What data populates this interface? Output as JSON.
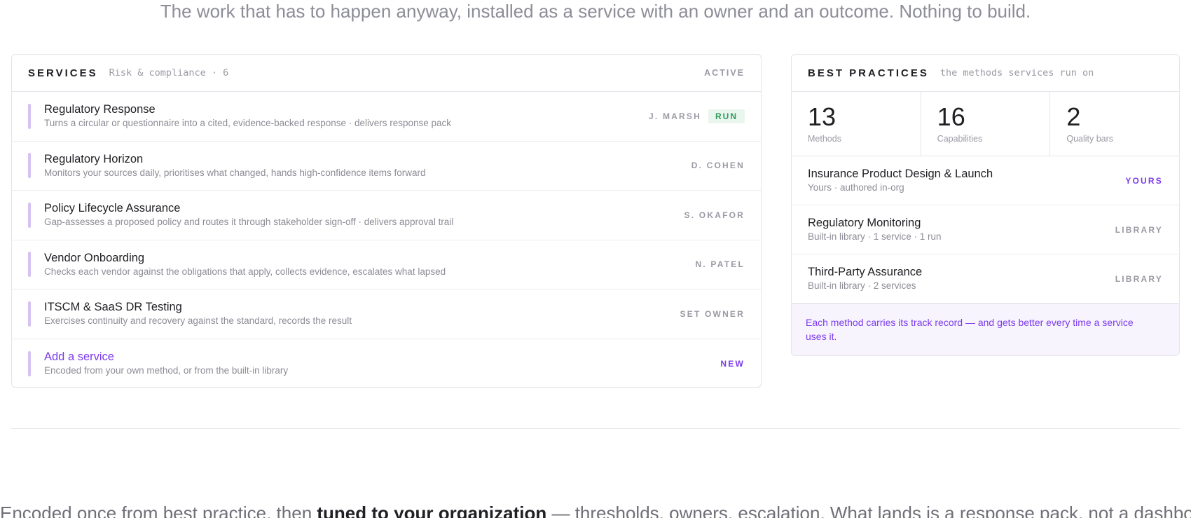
{
  "tagline": "The work that has to happen anyway, installed as a service with an owner and an outcome. Nothing to build.",
  "services": {
    "title": "SERVICES",
    "subtitle": "Risk & compliance · 6",
    "status": "ACTIVE",
    "rows": [
      {
        "name": "Regulatory Response",
        "desc": "Turns a circular or questionnaire into a cited, evidence-backed response · delivers response pack",
        "owner": "J. MARSH",
        "badge": "RUN"
      },
      {
        "name": "Regulatory Horizon",
        "desc": "Monitors your sources daily, prioritises what changed, hands high-confidence items forward",
        "owner": "D. COHEN"
      },
      {
        "name": "Policy Lifecycle Assurance",
        "desc": "Gap-assesses a proposed policy and routes it through stakeholder sign-off · delivers approval trail",
        "owner": "S. OKAFOR"
      },
      {
        "name": "Vendor Onboarding",
        "desc": "Checks each vendor against the obligations that apply, collects evidence, escalates what lapsed",
        "owner": "N. PATEL"
      },
      {
        "name": "ITSCM & SaaS DR Testing",
        "desc": "Exercises continuity and recovery against the standard, records the result",
        "owner": "SET OWNER"
      },
      {
        "name": "Add a service",
        "desc": "Encoded from your own method, or from the built-in library",
        "owner": "NEW"
      }
    ]
  },
  "practices": {
    "title": "BEST PRACTICES",
    "subtitle": "the methods services run on",
    "stats": [
      {
        "value": "13",
        "label": "Methods"
      },
      {
        "value": "16",
        "label": "Capabilities"
      },
      {
        "value": "2",
        "label": "Quality bars"
      }
    ],
    "rows": [
      {
        "name": "Insurance Product Design & Launch",
        "meta": "Yours · authored in-org",
        "tag": "YOURS"
      },
      {
        "name": "Regulatory Monitoring",
        "meta": "Built-in library · 1 service · 1 run",
        "tag": "LIBRARY"
      },
      {
        "name": "Third-Party Assurance",
        "meta": "Built-in library · 2 services",
        "tag": "LIBRARY"
      }
    ],
    "note": "Each method carries its track record — and gets better every time a service uses it."
  },
  "bottom": {
    "before": "Encoded once from best practice, then ",
    "strong": "tuned to your organization",
    "after": " — thresholds, owners, escalation. What lands is a response pack, not a dashboard."
  },
  "colors": {
    "accent": "#7c3aed",
    "run_green": "#2f9a5a",
    "bar": "#d5c2f2"
  }
}
